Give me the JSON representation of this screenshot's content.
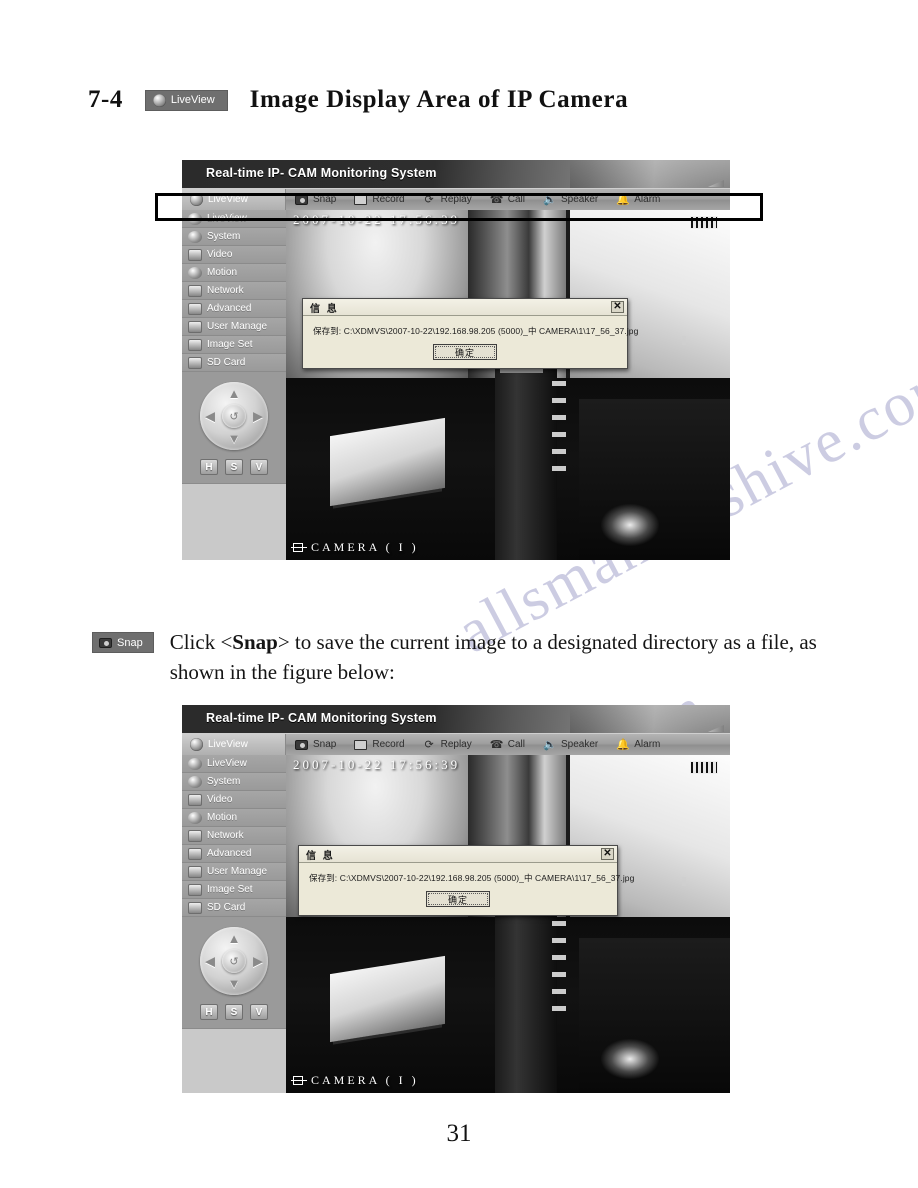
{
  "page": {
    "number": "31",
    "watermark": "allsmanualshive.com"
  },
  "heading": {
    "section_number": "7-4",
    "chip_label": "LiveView",
    "chip_icon": "liveview-disc-icon",
    "title": "Image Display Area of IP Camera"
  },
  "paragraph": {
    "chip_label": "Snap",
    "chip_icon": "snap-camera-icon",
    "text_before": "Click <",
    "emphasis": "Snap",
    "text_after": "> to save the current image to a designated directory as a file, as shown in the figure below:"
  },
  "app": {
    "title": "Real-time IP- CAM Monitoring System",
    "toolbar": [
      {
        "label": "LiveView",
        "icon": "liveview-disc-icon",
        "active": true
      },
      {
        "label": "Snap",
        "icon": "snap-camera-icon",
        "active": false
      },
      {
        "label": "Record",
        "icon": "record-tape-icon",
        "active": false
      },
      {
        "label": "Replay",
        "icon": "replay-swirl-icon",
        "active": false
      },
      {
        "label": "Call",
        "icon": "call-phone-icon",
        "active": false
      },
      {
        "label": "Speaker",
        "icon": "speaker-icon",
        "active": false
      },
      {
        "label": "Alarm",
        "icon": "alarm-bell-icon",
        "active": false
      }
    ],
    "sidebar": [
      {
        "label": "LiveView",
        "icon": "liveview-disc-icon"
      },
      {
        "label": "System",
        "icon": "system-gear-icon"
      },
      {
        "label": "Video",
        "icon": "video-camcorder-icon"
      },
      {
        "label": "Motion",
        "icon": "motion-icon"
      },
      {
        "label": "Network",
        "icon": "network-icon"
      },
      {
        "label": "Advanced",
        "icon": "advanced-icon"
      },
      {
        "label": "User Manage",
        "icon": "user-manage-icon"
      },
      {
        "label": "Image Set",
        "icon": "image-set-icon"
      },
      {
        "label": "SD Card",
        "icon": "sd-card-icon"
      }
    ],
    "ptz": {
      "up_icon": "chevron-up-icon",
      "down_icon": "chevron-down-icon",
      "left_icon": "chevron-left-icon",
      "right_icon": "chevron-right-icon",
      "center_icon": "ptz-reset-icon",
      "center_glyph": "↺",
      "buttons": [
        "H",
        "S",
        "V"
      ]
    },
    "osd": {
      "timestamp": "2007-10-22  17:56:39",
      "camera_label": "CAMERA ( I )",
      "camera_icon": "camera-channel-icon",
      "corner_icon": "video-indicator-icon"
    },
    "dialog": {
      "title": "信 息",
      "close_icon": "close-icon",
      "close_glyph": "✕",
      "message": "保存到: C:\\XDMVS\\2007-10-22\\192.168.98.205 (5000)_中 CAMERA\\1\\17_56_37.jpg",
      "ok_label": "确定"
    }
  },
  "figures": [
    {
      "name": "figure-liveview-toolbar-highlight",
      "highlight_toolbar": true
    },
    {
      "name": "figure-snap-saved-dialog",
      "highlight_toolbar": false
    }
  ],
  "colors": {
    "chip_bg": "#6f6f6f",
    "titlebar": "#2b2b2b",
    "toolbar": "#9d9d9d",
    "sidebar": "#9a9a9a",
    "dialog_bg": "#ece9d8",
    "highlight": "#000000"
  }
}
